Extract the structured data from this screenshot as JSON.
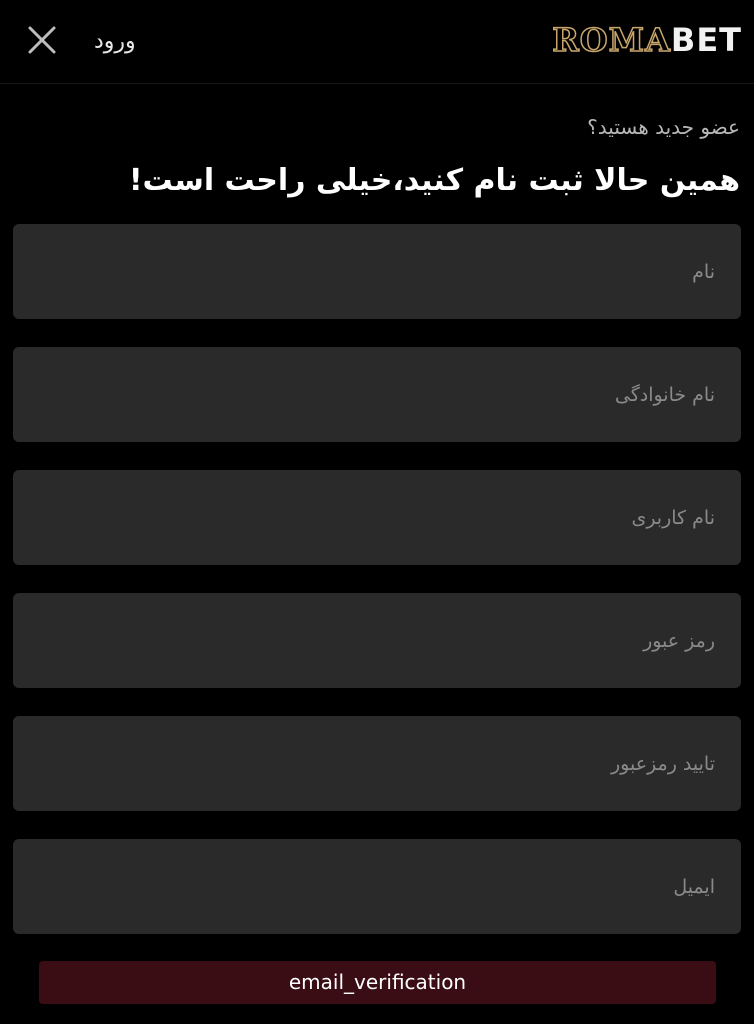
{
  "header": {
    "login_label": "ورود",
    "logo_part1": "ROMA",
    "logo_part2": "BET"
  },
  "intro": {
    "subtitle": "عضو جدید هستید؟",
    "title": "همین حالا ثبت نام کنید،خیلی راحت است!"
  },
  "form": {
    "first_name_placeholder": "نام",
    "last_name_placeholder": "نام خانوادگی",
    "username_placeholder": "نام کاربری",
    "password_placeholder": "رمز عبور",
    "confirm_password_placeholder": "تایید رمزعبور",
    "email_placeholder": "ایمیل",
    "email_verification_label": "email_verification"
  },
  "icons": {
    "close": "close-icon"
  },
  "colors": {
    "background": "#000000",
    "field_background": "#2a2a2a",
    "button_background": "#3a0d14",
    "logo_gold": "#c9a66b"
  }
}
